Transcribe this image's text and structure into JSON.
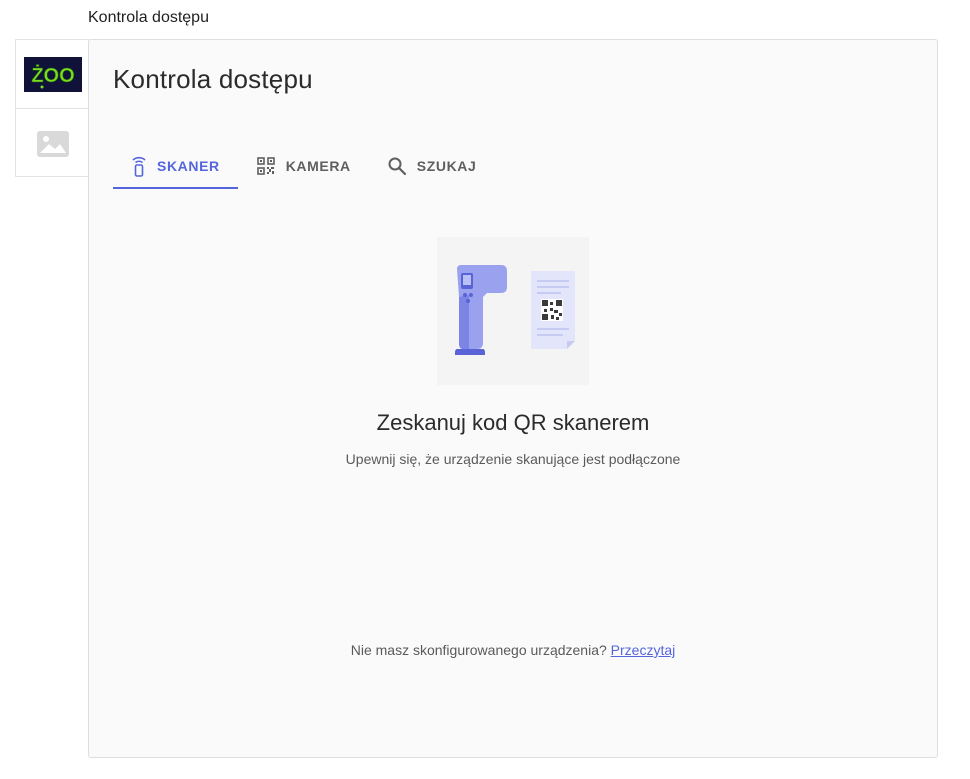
{
  "window": {
    "title": "Kontrola dostępu"
  },
  "sidebar": {
    "items": [
      {
        "name": "zoo-logo",
        "logo_text": "ŻOO"
      },
      {
        "name": "image-placeholder"
      }
    ]
  },
  "main": {
    "title": "Kontrola dostępu",
    "tabs": [
      {
        "label": "SKANER",
        "icon": "scanner-icon",
        "active": true
      },
      {
        "label": "KAMERA",
        "icon": "qr-code-icon",
        "active": false
      },
      {
        "label": "SZUKAJ",
        "icon": "search-icon",
        "active": false
      }
    ],
    "scanner": {
      "heading": "Zeskanuj kod QR skanerem",
      "subheading": "Upewnij się, że urządzenie skanujące jest podłączone",
      "footer_prefix": "Nie masz skonfigurowanego urządzenia?",
      "footer_link": "Przeczytaj"
    }
  },
  "colors": {
    "accent": "#5566dd",
    "text": "#2b2b2b",
    "muted": "#5a5a5a",
    "card_bg": "#fafafa",
    "logo_bg": "#10123a",
    "logo_green": "#7ddc1f"
  }
}
